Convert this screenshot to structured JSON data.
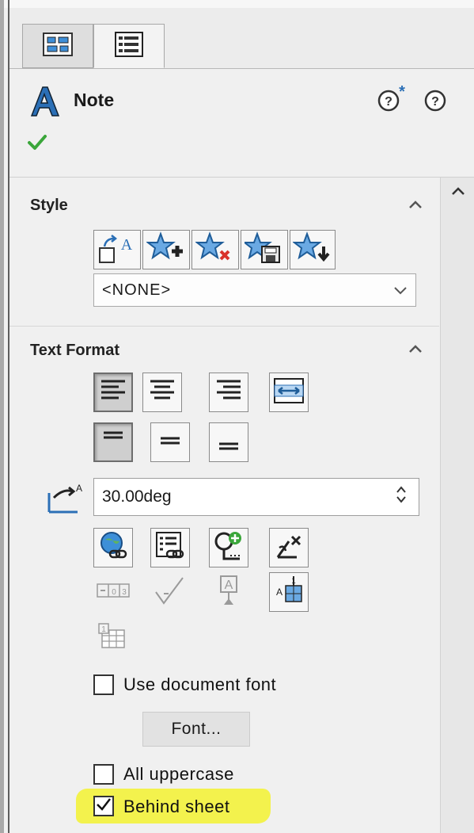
{
  "panel": {
    "title": "Note",
    "tabs": [
      {
        "icon": "feature-tree-icon",
        "active": false
      },
      {
        "icon": "property-manager-icon",
        "active": true
      }
    ],
    "help_icons": [
      "whats-new-help-icon",
      "help-icon"
    ],
    "confirm_icon": "green-checkmark-icon"
  },
  "style_section": {
    "title": "Style",
    "buttons": [
      "apply-default-style-icon",
      "add-style-icon",
      "delete-style-icon",
      "save-style-icon",
      "load-style-icon"
    ],
    "selected": "<NONE>"
  },
  "text_format": {
    "title": "Text Format",
    "align_buttons": [
      "align-left-icon",
      "align-center-icon",
      "align-right-icon",
      "fit-text-icon"
    ],
    "vertical_buttons": [
      "align-top-icon",
      "align-middle-icon",
      "align-bottom-icon"
    ],
    "angle_value": "30.00deg",
    "insert_row1": [
      "insert-hyperlink-icon",
      "link-to-property-icon",
      "add-symbol-icon",
      "lock-unlock-note-icon"
    ],
    "insert_row2": [
      "insert-gtol-icon",
      "insert-surface-finish-icon",
      "insert-datum-feature-icon",
      "stack-note-icon"
    ],
    "insert_row3": [
      "insert-table-icon"
    ],
    "use_document_font": {
      "label": "Use document font",
      "checked": false
    },
    "font_button": "Font...",
    "all_uppercase": {
      "label": "All uppercase",
      "checked": false
    },
    "behind_sheet": {
      "label": "Behind sheet",
      "checked": true
    }
  },
  "colors": {
    "accent_blue": "#2b6fb6",
    "check_green": "#3aa63a",
    "highlight": "#f3f24d"
  }
}
